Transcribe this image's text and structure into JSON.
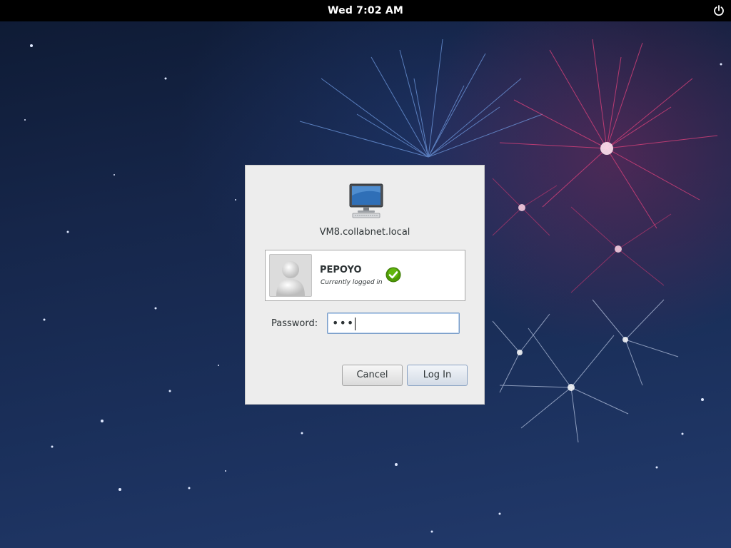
{
  "topbar": {
    "clock": "Wed  7:02 AM",
    "power_icon": "power-icon"
  },
  "dialog": {
    "computer_icon": "computer-icon",
    "hostname": "VM8.collabnet.local",
    "user": {
      "name": "PEPOYO",
      "status": "Currently logged in",
      "avatar_icon": "user-avatar-icon",
      "status_icon": "checkmark-icon"
    },
    "password": {
      "label": "Password:",
      "value": "•••"
    },
    "buttons": {
      "cancel": "Cancel",
      "login": "Log In"
    }
  },
  "colors": {
    "topbar": "#000000",
    "dialog_bg": "#ededed",
    "check_green": "#4e9a06",
    "field_focus": "#7a9dc8"
  }
}
